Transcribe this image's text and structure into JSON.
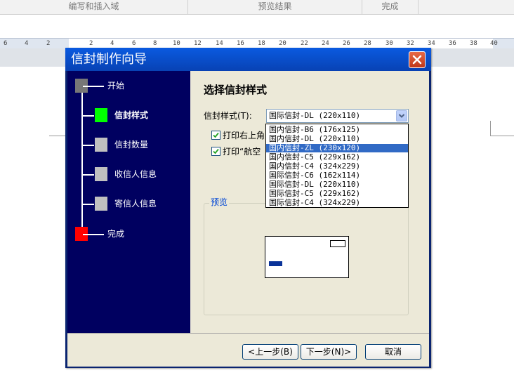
{
  "background_table": {
    "headers": [
      "编写和插入域",
      "预览结果",
      "完成"
    ]
  },
  "ruler": {
    "numbers": [
      "6",
      "4",
      "2",
      "2",
      "4",
      "6",
      "8",
      "10",
      "12",
      "14",
      "16",
      "18",
      "20",
      "22",
      "24",
      "26",
      "28",
      "30",
      "32",
      "34",
      "36",
      "38",
      "40"
    ]
  },
  "dialog": {
    "title": "信封制作向导",
    "steps": [
      "开始",
      "信封样式",
      "信封数量",
      "收信人信息",
      "寄信人信息",
      "完成"
    ],
    "current_step_index": 1,
    "heading": "选择信封样式",
    "style_label": "信封样式(T):",
    "style_value": "国际信封-DL (220x110)",
    "checkbox1_label": "打印右上角",
    "checkbox1_checked": true,
    "checkbox2_label": "打印“航空",
    "checkbox2_checked": true,
    "preview_title": "预览",
    "dropdown_options": [
      "国内信封-B6 (176x125)",
      "国内信封-DL (220x110)",
      "国内信封-ZL (230x120)",
      "国内信封-C5 (229x162)",
      "国内信封-C4 (324x229)",
      "国际信封-C6 (162x114)",
      "国际信封-DL (220x110)",
      "国际信封-C5 (229x162)",
      "国际信封-C4 (324x229)"
    ],
    "highlighted_option_index": 2,
    "buttons": {
      "prev": "<上一步(B)",
      "next": "下一步(N)>",
      "cancel": "取消"
    }
  },
  "colors": {
    "step_start": "#777777",
    "step_current": "#00ff00",
    "step_pending": "#c0c0c0",
    "step_finish": "#ff0000",
    "title_bar": "#0842b4",
    "left_panel": "#000060"
  }
}
